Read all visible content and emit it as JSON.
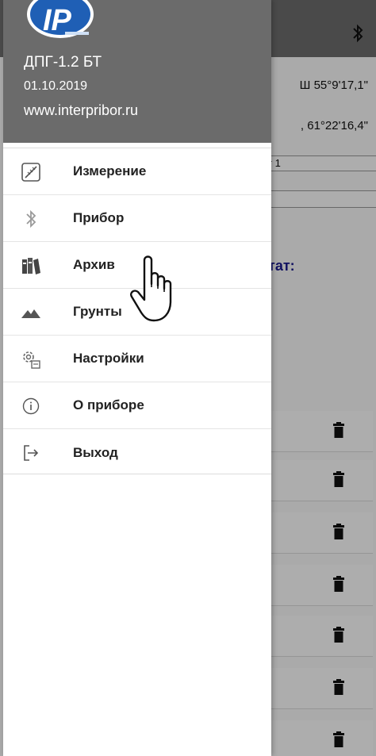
{
  "drawer": {
    "header": {
      "device_name": "ДПГ-1.2 БТ",
      "date": "01.10.2019",
      "website": "www.interpribor.ru"
    },
    "items": [
      {
        "label": "Измерение",
        "icon": "ruler-gauge-icon"
      },
      {
        "label": "Прибор",
        "icon": "bluetooth-icon"
      },
      {
        "label": "Архив",
        "icon": "archive-books-icon"
      },
      {
        "label": "Грунты",
        "icon": "mountains-icon"
      },
      {
        "label": "Настройки",
        "icon": "gears-settings-icon"
      },
      {
        "label": "О приборе",
        "icon": "info-icon"
      },
      {
        "label": "Выход",
        "icon": "exit-icon"
      }
    ]
  },
  "background": {
    "latitude": "Ш 55°9'17,1\"",
    "longitude": ", 61°22'16,4\"",
    "field1_value": "т 1",
    "result_label": "тат:",
    "trash_rows": 7
  },
  "colors": {
    "header_gray": "#6b6b6b",
    "result_blue": "#1a1a8e",
    "logo_blue": "#1f5fb5"
  }
}
